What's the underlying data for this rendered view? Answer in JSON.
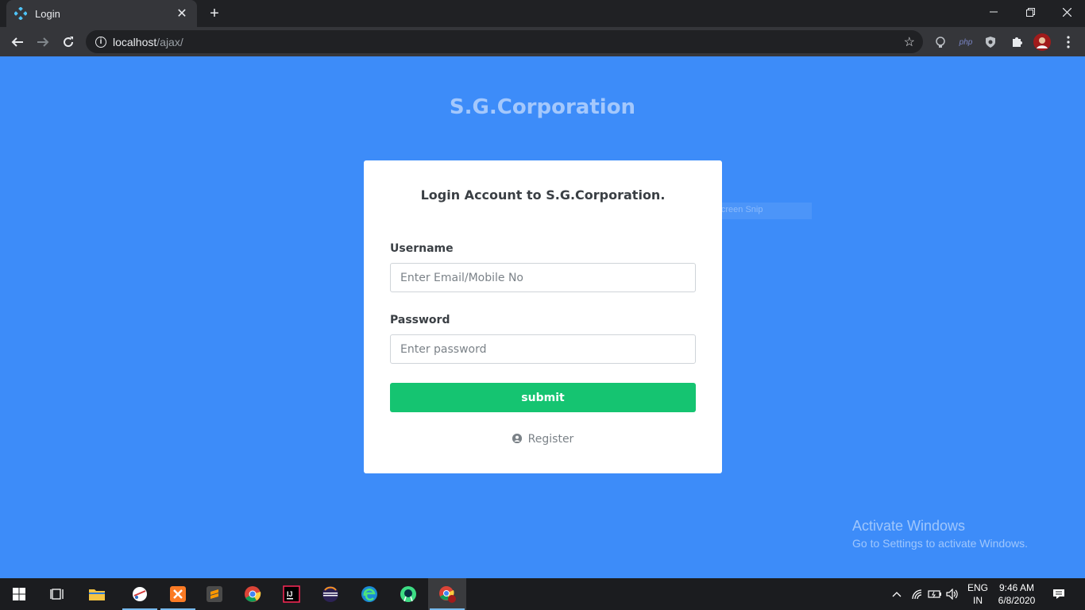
{
  "browser": {
    "tab_title": "Login",
    "url_host": "localhost",
    "url_path": "/ajax/",
    "ext_php_label": "php"
  },
  "page": {
    "brand": "S.G.Corporation",
    "card_title": "Login Account to S.G.Corporation.",
    "username_label": "Username",
    "username_placeholder": "Enter Email/Mobile No",
    "password_label": "Password",
    "password_placeholder": "Enter password",
    "submit_label": "submit",
    "register_label": "Register",
    "snip_tooltip": "Full-screen Snip"
  },
  "watermark": {
    "line1": "Activate Windows",
    "line2": "Go to Settings to activate Windows."
  },
  "taskbar": {
    "lang_line1": "ENG",
    "lang_line2": "IN",
    "time": "9:46 AM",
    "date": "6/8/2020"
  },
  "colors": {
    "page_bg": "#3d8cf9",
    "submit_bg": "#15c471",
    "brand_text": "#a4c8fc"
  }
}
